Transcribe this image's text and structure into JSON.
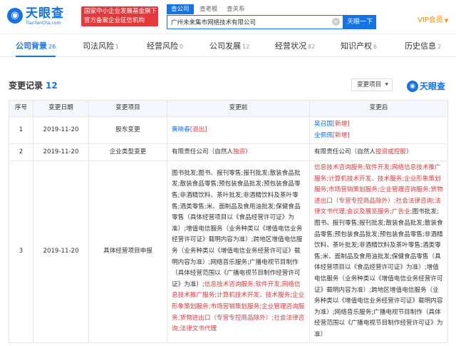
{
  "header": {
    "logo_text": "天眼查",
    "logo_sub": "TianYanCha.com",
    "fund_line1": "国家中小企业发展基金旗下",
    "fund_line2": "官方备案企业征信机构",
    "search_tabs": [
      "查公司",
      "查老板",
      "查关系"
    ],
    "search_value": "广州未来集市网络技术有限公司",
    "search_button": "天眼一下",
    "vip": "VIP会员"
  },
  "tabs": [
    {
      "label": "公司背景",
      "count": "26"
    },
    {
      "label": "司法风险",
      "count": "1"
    },
    {
      "label": "经营风险",
      "count": "0"
    },
    {
      "label": "公司发展",
      "count": "12"
    },
    {
      "label": "经营状况",
      "count": "82"
    },
    {
      "label": "知识产权",
      "count": "6"
    },
    {
      "label": "历史信息",
      "count": "2"
    }
  ],
  "section": {
    "title": "变更记录",
    "count": "12",
    "dropdown": "变更项目",
    "watermark": "天眼查"
  },
  "table": {
    "headers": [
      "序号",
      "变更日期",
      "变更项目",
      "变更前",
      "变更后"
    ],
    "rows": [
      {
        "index": "1",
        "date": "2019-11-20",
        "item": "股东变更",
        "before_name": "黄晓春",
        "before_tag": "[退出]",
        "after_name1": "吴召国",
        "after_tag1": "[新增]",
        "after_name2": "全佩佩",
        "after_tag2": "[新增]"
      },
      {
        "index": "2",
        "date": "2019-11-20",
        "item": "企业类型变更",
        "before_plain": "有限责任公司（自然人",
        "before_red": "独资",
        "before_end": "）",
        "after_plain": "有限责任公司（自然人",
        "after_red": "投资或控股",
        "after_end": "）"
      },
      {
        "index": "3",
        "date": "2019-11-20",
        "item": "具体经营项目申报",
        "before_black": "图书批发;图书、报刊零售;报刊批发;散装食品批发;散装食品零售;预包装食品批发;预包装食品零售;非酒精饮料、茶叶批发;非酒精饮料及茶叶零售;酒类零售;米、面制品及食用油批发;保健食品零售（具体经营项目以《食品经营许可证》为准）;增值电信服务（业务种类以《增值电信业务经营许可证》载明内容为准）;跨地区增值电信服务（业务种类以《增值电信业务经营许可证》载明内容为准）;网络音乐服务;广播电视节目制作（具体经营范围以《广播电视节目制作经营许可证》为准）;",
        "before_red": "信息技术咨询服务;软件开发;网络信息技术推广服务;计算机技术开发、技术服务;企业形象策划服务;市场营销策划服务;企业管理咨询服务;货物进出口（专营专控商品除外）;社会法律咨询;法律文书代理",
        "after_red": "信息技术咨询服务;软件开发;网络信息技术推广服务;计算机技术开发、技术服务;企业形象策划服务;市场营销策划服务;企业管理咨询服务;货物进出口（专营专控商品除外）;社会法律咨询;法律文书代理;会议及展览服务;广告业;",
        "after_black": "图书批发;图书、报刊零售;报刊批发;散装食品批发;散装食品零售;预包装食品批发;预包装食品零售;非酒精饮料、茶叶批发;非酒精饮料及茶叶零售;酒类零售;米、面制品及食用油批发;保健食品零售（具体经营项目以《食品经营许可证》为准）;增值电信服务（业务种类以《增值电信业务经营许可证》载明内容为准）;跨地区增值电信服务（业务种类以《增值电信业务经营许可证》载明内容为准）;网络音乐服务;广播电视节目制作（具体经营范围以《广播电视节目制作经营许可证》为准）"
      }
    ]
  },
  "colors": {
    "brand": "#1473e6",
    "red": "#e4393c",
    "vip": "#ff8a00"
  }
}
